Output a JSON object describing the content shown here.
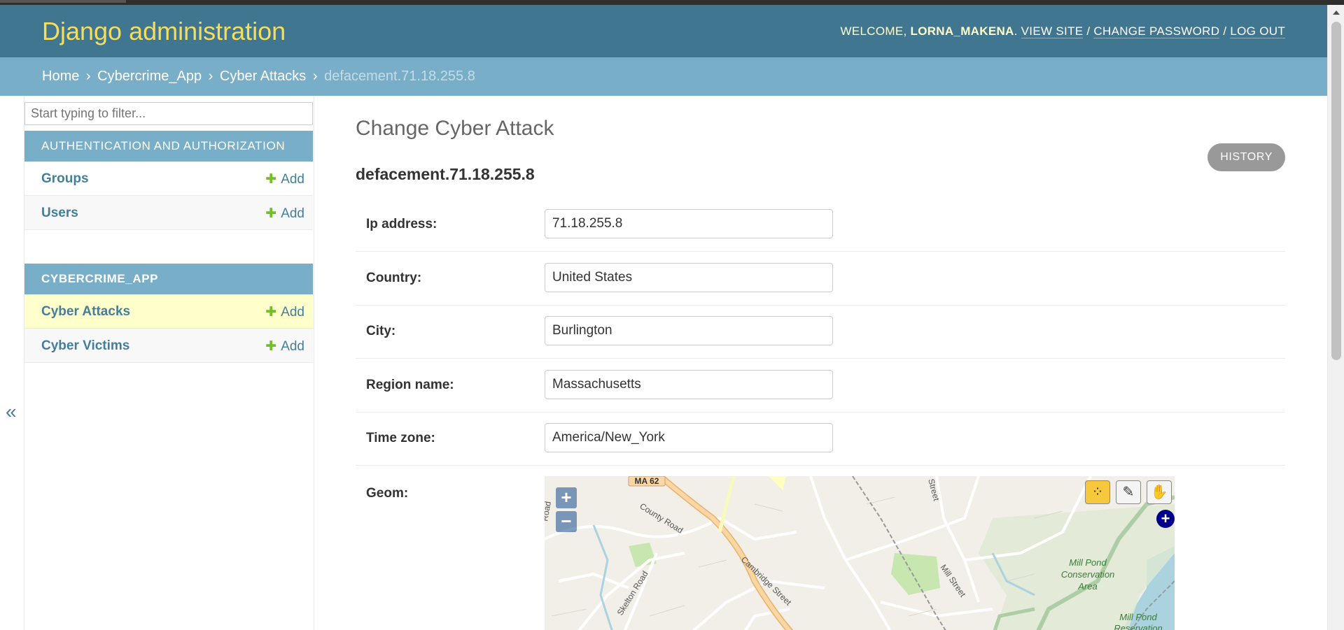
{
  "header": {
    "brand": "Django administration",
    "welcome": "WELCOME,",
    "username": "LORNA_MAKENA",
    "view_site": "VIEW SITE",
    "change_password": "CHANGE PASSWORD",
    "log_out": "LOG OUT",
    "sep": "/"
  },
  "breadcrumbs": {
    "home": "Home",
    "app": "Cybercrime_App",
    "model": "Cyber Attacks",
    "current": "defacement.71.18.255.8",
    "sep": "›"
  },
  "sidebar": {
    "filter_placeholder": "Start typing to filter...",
    "toggle": "«",
    "modules": [
      {
        "caption": "AUTHENTICATION AND AUTHORIZATION",
        "items": [
          {
            "label": "Groups",
            "add": "Add"
          },
          {
            "label": "Users",
            "add": "Add"
          }
        ]
      },
      {
        "caption": "CYBERCRIME_APP",
        "items": [
          {
            "label": "Cyber Attacks",
            "add": "Add"
          },
          {
            "label": "Cyber Victims",
            "add": "Add"
          }
        ]
      }
    ]
  },
  "main": {
    "title": "Change Cyber Attack",
    "history": "HISTORY",
    "object_name": "defacement.71.18.255.8",
    "fields": [
      {
        "label": "Ip address:",
        "value": "71.18.255.8"
      },
      {
        "label": "Country:",
        "value": "United States"
      },
      {
        "label": "City:",
        "value": "Burlington"
      },
      {
        "label": "Region name:",
        "value": "Massachusetts"
      },
      {
        "label": "Time zone:",
        "value": "America/New_York"
      }
    ],
    "geom_label": "Geom:"
  },
  "map": {
    "zoom_in": "+",
    "zoom_out": "−",
    "labels": {
      "ma62": "MA 62",
      "county_road": "County Road",
      "cambridge_street": "Cambridge Street",
      "skelton_road": "Skelton Road",
      "mill_street": "Mill Street",
      "street_top": "Street",
      "road_left": "Road",
      "mill_pond_area_1": "Mill Pond",
      "mill_pond_area_2": "Conservation",
      "mill_pond_area_3": "Area",
      "mill_pond_res_1": "Mill Pond",
      "mill_pond_res_2": "Reservation"
    }
  },
  "colors": {
    "header": "#417690",
    "brand": "#f5dd5d",
    "breadcrumbs": "#79aec8",
    "link": "#447e9b",
    "add_plus": "#70bf2b",
    "current_row": "#ffffcc"
  }
}
